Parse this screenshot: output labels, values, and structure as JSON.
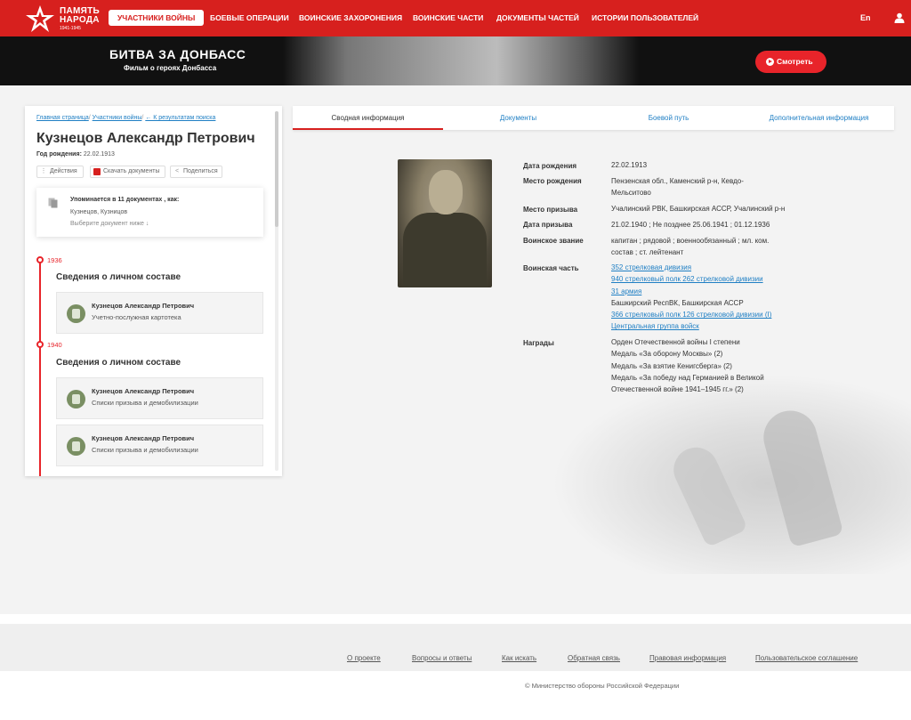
{
  "logo": {
    "line1": "ПАМЯТЬ",
    "line2": "НАРОДА",
    "years": "1941-1945"
  },
  "nav": {
    "items": [
      "Участники войны",
      "Боевые операции",
      "Воинские захоронения",
      "Воинские части",
      "Документы частей",
      "Истории пользователей"
    ],
    "lang": "En"
  },
  "banner": {
    "title": "БИТВА ЗА ДОНБАСС",
    "subtitle": "Фильм о героях Донбасса",
    "button": "Смотреть"
  },
  "breadcrumb": {
    "home": "Главная страница",
    "sep1": "/",
    "war": "Участники войны",
    "sep2": "/",
    "back": "← К результатам поиска"
  },
  "person": {
    "name": "Кузнецов Александр Петрович",
    "birth_label": "Год рождения:",
    "birth_value": "22.02.1913"
  },
  "actions": {
    "actions": "Действия",
    "download": "Скачать документы",
    "share": "Поделиться"
  },
  "mention": {
    "title": "Упоминается в 11 документах , как:",
    "names": "Кузнецов, Кузницов",
    "hint": "Выберите документ ниже ↓"
  },
  "timeline": [
    {
      "year": "1936",
      "title": "Сведения о личном составе",
      "entries": [
        {
          "name": "Кузнецов Александр Петрович",
          "doc": "Учетно-послужная картотека"
        }
      ]
    },
    {
      "year": "1940",
      "title": "Сведения о личном составе",
      "entries": [
        {
          "name": "Кузнецов Александр Петрович",
          "doc": "Списки призыва и демобилизации"
        },
        {
          "name": "Кузнецов Александр Петрович",
          "doc": "Списки призыва и демобилизации"
        }
      ]
    }
  ],
  "tabs": [
    "Сводная информация",
    "Документы",
    "Боевой путь",
    "Дополнительная информация"
  ],
  "info": {
    "birth_date": {
      "label": "Дата рождения",
      "value": "22.02.1913"
    },
    "birth_place": {
      "label": "Место рождения",
      "lines": [
        "Пензенская обл., Каменский р-н, Кевдо-",
        "Мельситово"
      ]
    },
    "draft_place": {
      "label": "Место призыва",
      "value": "Учалинский РВК, Башкирская АССР, Учалинский р-н"
    },
    "draft_date": {
      "label": "Дата призыва",
      "value": "21.02.1940 ; Не позднее 25.06.1941 ; 01.12.1936"
    },
    "rank": {
      "label": "Воинское звание",
      "lines": [
        "капитан ; рядовой ; военнообязанный ; мл. ком.",
        "состав ; ст. лейтенант"
      ]
    },
    "unit": {
      "label": "Воинская часть",
      "links1": [
        "352 стрелковая дивизия",
        "940 стрелковый полк 262 стрелковой дивизии",
        "31 армия"
      ],
      "text": "Башкирский РеспВК, Башкирская АССР",
      "links2": [
        "366 стрелковый полк 126 стрелковой дивизии (I)",
        "Центральная группа войск"
      ]
    },
    "awards": {
      "label": "Награды",
      "lines": [
        "Орден Отечественной войны I степени",
        "Медаль «За оборону Москвы» (2)",
        "Медаль «За взятие Кенигсберга» (2)",
        "Медаль «За победу над Германией в Великой",
        "Отечественной войне 1941–1945 гг.» (2)"
      ]
    }
  },
  "footer": {
    "links": [
      "О проекте",
      "Вопросы и ответы",
      "Как искать",
      "Обратная связь",
      "Правовая информация",
      "Пользовательское соглашение"
    ],
    "copyright": "© Министерство обороны Российской Федерации"
  },
  "colors": {
    "brand_red": "#d7201e",
    "link_blue": "#1f7fc4"
  }
}
